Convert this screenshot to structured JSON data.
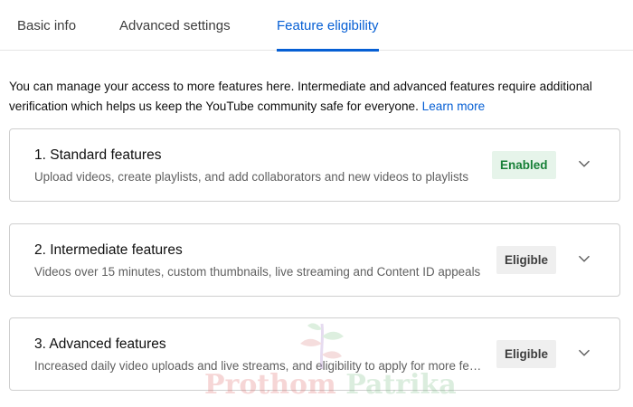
{
  "tabs": [
    {
      "label": "Basic info",
      "active": false
    },
    {
      "label": "Advanced settings",
      "active": false
    },
    {
      "label": "Feature eligibility",
      "active": true
    }
  ],
  "intro": {
    "text": "You can manage your access to more features here. Intermediate and advanced features require additional verification which helps us keep the YouTube community safe for everyone. ",
    "link": "Learn more"
  },
  "features": [
    {
      "title": "1. Standard features",
      "description": "Upload videos, create playlists, and add collaborators and new videos to playlists",
      "status": "Enabled",
      "status_color": "#188038"
    },
    {
      "title": "2. Intermediate features",
      "description": "Videos over 15 minutes, custom thumbnails, live streaming and Content ID appeals",
      "status": "Eligible",
      "status_color": "#3d3d3d"
    },
    {
      "title": "3. Advanced features",
      "description": "Increased daily video uploads and live streams, and eligibility to apply for more features",
      "status": "Eligible",
      "status_color": "#3d3d3d"
    }
  ],
  "icons": {
    "expand": "chevron-down-icon"
  },
  "colors": {
    "accent": "#065fd4",
    "enabled_bg": "#e6f4ea",
    "eligible_bg": "#efefef"
  },
  "watermark": {
    "text_part1": "Prothom",
    "text_part2": "Patrika"
  }
}
